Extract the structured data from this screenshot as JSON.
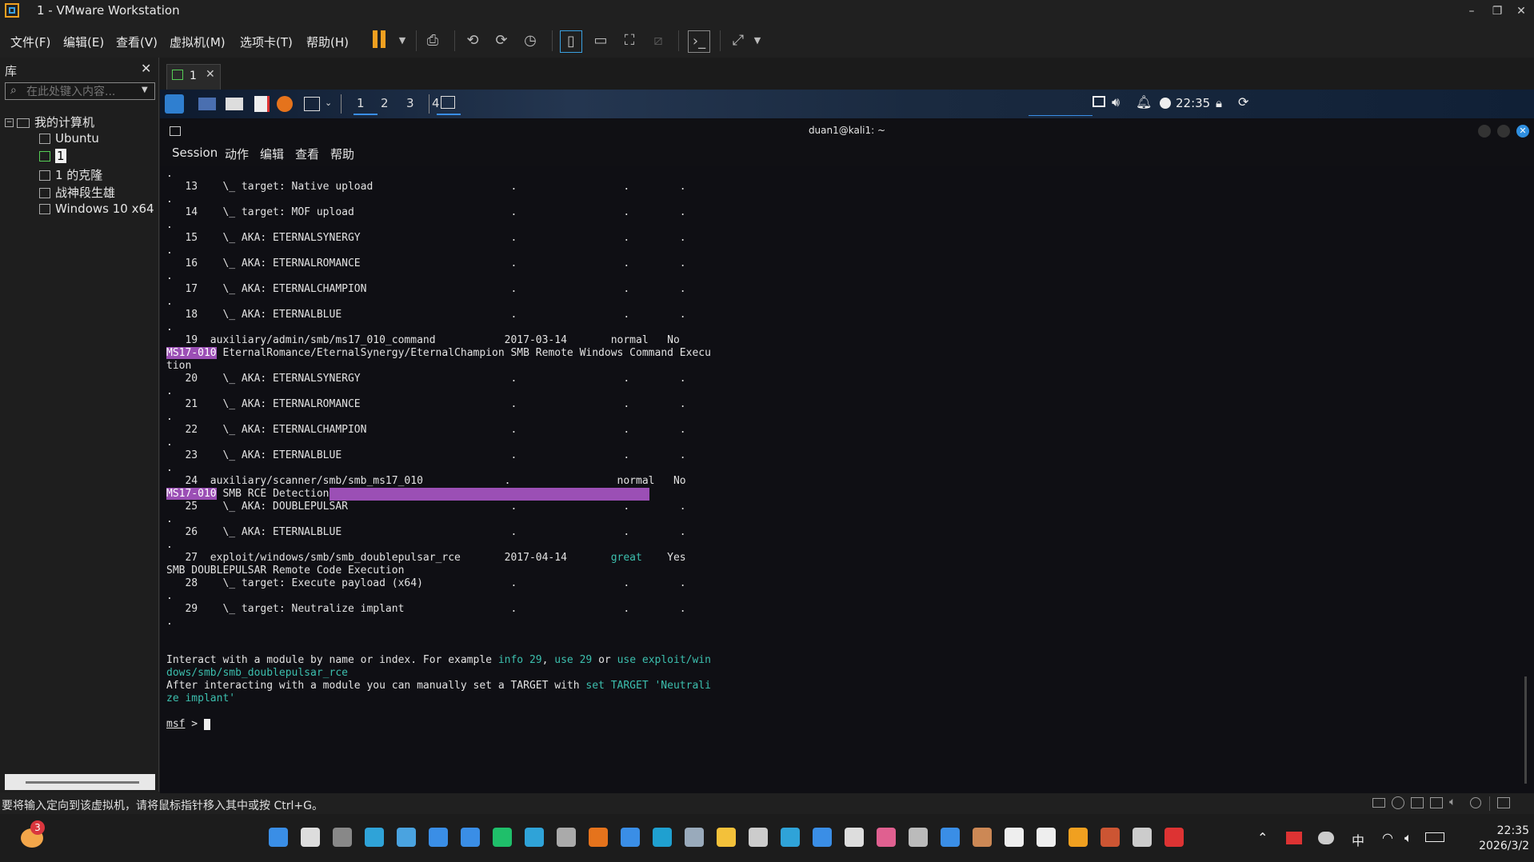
{
  "window": {
    "title": "1 - VMware Workstation"
  },
  "menu": [
    "文件(F)",
    "编辑(E)",
    "查看(V)",
    "虚拟机(M)",
    "选项卡(T)",
    "帮助(H)"
  ],
  "library": {
    "header": "库",
    "search_placeholder": "在此处键入内容...",
    "root": "我的计算机",
    "items": [
      "Ubuntu",
      "1",
      "1 的克隆",
      "战神段生雄",
      "Windows 10 x64"
    ]
  },
  "vm_tab": {
    "label": "1"
  },
  "kali": {
    "workspaces": [
      "1",
      "2",
      "3",
      "4"
    ],
    "time": "22:35",
    "terminal_title": "duan1@kali1: ~",
    "terminal_menu": [
      "Session",
      "动作",
      "编辑",
      "查看",
      "帮助"
    ]
  },
  "terminal": {
    "rows": [
      {
        "t": "."
      },
      {
        "t": "   13    \\_ target: Native upload                      .                 .        ."
      },
      {
        "t": "."
      },
      {
        "t": "   14    \\_ target: MOF upload                         .                 .        ."
      },
      {
        "t": "."
      },
      {
        "t": "   15    \\_ AKA: ETERNALSYNERGY                        .                 .        ."
      },
      {
        "t": "."
      },
      {
        "t": "   16    \\_ AKA: ETERNALROMANCE                        .                 .        ."
      },
      {
        "t": "."
      },
      {
        "t": "   17    \\_ AKA: ETERNALCHAMPION                       .                 .        ."
      },
      {
        "t": "."
      },
      {
        "t": "   18    \\_ AKA: ETERNALBLUE                           .                 .        ."
      },
      {
        "t": "."
      },
      {
        "t": "   19  auxiliary/admin/smb/ms17_010_command           2017-03-14       normal   No"
      },
      {
        "h": "MS17-010",
        "t": " EternalRomance/EternalSynergy/EternalChampion SMB Remote Windows Command Execu"
      },
      {
        "t": "tion"
      },
      {
        "t": "   20    \\_ AKA: ETERNALSYNERGY                        .                 .        ."
      },
      {
        "t": "."
      },
      {
        "t": "   21    \\_ AKA: ETERNALROMANCE                        .                 .        ."
      },
      {
        "t": "."
      },
      {
        "t": "   22    \\_ AKA: ETERNALCHAMPION                       .                 .        ."
      },
      {
        "t": "."
      },
      {
        "t": "   23    \\_ AKA: ETERNALBLUE                           .                 .        ."
      },
      {
        "t": "."
      },
      {
        "t": "   24  auxiliary/scanner/smb/smb_ms17_010             .                 normal   No"
      },
      {
        "h": "MS17-010",
        "t": " SMB RCE Detection",
        "bar": true
      },
      {
        "t": "   25    \\_ AKA: DOUBLEPULSAR                          .                 .        ."
      },
      {
        "t": "."
      },
      {
        "t": "   26    \\_ AKA: ETERNALBLUE                           .                 .        ."
      },
      {
        "t": "."
      },
      {
        "t": "   27  exploit/windows/smb/smb_doublepulsar_rce       2017-04-14       ",
        "g": "great",
        "t2": "    Yes"
      },
      {
        "t": "SMB DOUBLEPULSAR Remote Code Execution"
      },
      {
        "t": "   28    \\_ target: Execute payload (x64)              .                 .        ."
      },
      {
        "t": "."
      },
      {
        "t": "   29    \\_ target: Neutralize implant                 .                 .        ."
      },
      {
        "t": "."
      },
      {
        "t": ""
      },
      {
        "t": ""
      },
      {
        "t": "Interact with a module by name or index. For example ",
        "c": "info 29",
        "t2": ", ",
        "c2": "use 29",
        "t3": " or ",
        "c3": "use exploit/win"
      },
      {
        "c": "dows/smb/smb_doublepulsar_rce"
      },
      {
        "t": "After interacting with a module you can manually set a TARGET with ",
        "c": "set TARGET 'Neutrali"
      },
      {
        "c": "ze implant'"
      },
      {
        "t": ""
      },
      {
        "p": "msf",
        "t": " > "
      }
    ]
  },
  "status": {
    "message": "要将输入定向到该虚拟机，请将鼠标指针移入其中或按 Ctrl+G。"
  },
  "taskbar": {
    "badge": "3",
    "time": "22:35",
    "date": "2026/3/2",
    "ime": "中"
  }
}
